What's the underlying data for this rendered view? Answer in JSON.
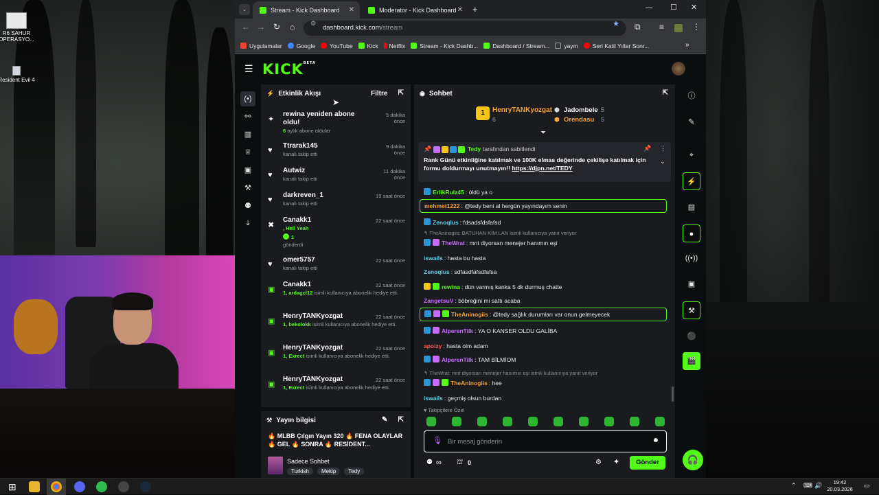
{
  "desktop": {
    "icons": [
      {
        "label": "R6 SAHUR OPERASYO..."
      },
      {
        "label": "Resident Evil 4"
      }
    ]
  },
  "browser": {
    "tabs": [
      {
        "label": "Stream - Kick Dashboard",
        "active": true
      },
      {
        "label": "Moderator - Kick Dashboard",
        "active": false
      }
    ],
    "new_tab_icon": "plus-icon",
    "url_host": "dashboard.kick.com",
    "url_path": "/stream",
    "bookmarks": [
      {
        "label": "Uygulamalar",
        "color": "#ea4335"
      },
      {
        "label": "Google",
        "color": "#4285f4"
      },
      {
        "label": "YouTube",
        "color": "#ff0000"
      },
      {
        "label": "Kick",
        "color": "#53fc18"
      },
      {
        "label": "Netflix",
        "color": "#e50914"
      },
      {
        "label": "Stream - Kick Dashb...",
        "color": "#53fc18"
      },
      {
        "label": "Dashboard / Stream...",
        "color": "#53fc18"
      },
      {
        "label": "yayın",
        "color": "#9aa0a6"
      },
      {
        "label": "Seri Katil Yıllar Sonr...",
        "color": "#ff0000"
      }
    ]
  },
  "kick": {
    "logo": "KICK",
    "logo_badge": "BETA",
    "accent": "#53fc18",
    "activity": {
      "title": "Etkinlik Akışı",
      "filter_label": "Filtre",
      "items": [
        {
          "name": "rewina yeniden abone oldu!",
          "sub_highlight": "6",
          "sub": " aylık abone oldular",
          "time": "5 dakika önce",
          "icon": "sparkle-icon"
        },
        {
          "name": "Ttrarak145",
          "sub": "kanalı takip etti",
          "time": "9 dakika önce",
          "icon": "heart-icon"
        },
        {
          "name": "Autwiz",
          "sub": "kanalı takip etti",
          "time": "11 dakika önce",
          "icon": "heart-icon"
        },
        {
          "name": "darkreven_1",
          "sub": "kanalı takip etti",
          "time": "19 saat önce",
          "icon": "heart-icon"
        },
        {
          "name": "Canakk1",
          "sub_highlight": ", Hell Yeah",
          "sub_count": "1",
          "sub": "gönderdi",
          "time": "22 saat önce",
          "icon": "kicks-icon"
        },
        {
          "name": "omer5757",
          "sub": "kanalı takip etti",
          "time": "22 saat önce",
          "icon": "heart-icon"
        },
        {
          "name": "Canakk1",
          "sub_highlight": "1, ardagcl12",
          "sub": " isimli kullanıcıya abonelik hediye etti.",
          "time": "22 saat önce",
          "icon": "gift-icon"
        },
        {
          "name": "HenryTANKyozgat",
          "sub_highlight": "1, bekolokk",
          "sub": " isimli kullanıcıya abonelik hediye etti.",
          "time": "22 saat önce",
          "icon": "gift-icon"
        },
        {
          "name": "HenryTANKyozgat",
          "sub_highlight": "1, Exrect",
          "sub": " isimli kullanıcıya abonelik hediye etti.",
          "time": "22 saat önce",
          "icon": "gift-icon"
        },
        {
          "name": "HenryTANKyozgat",
          "sub_highlight": "1, Exrect",
          "sub": " isimli kullanıcıya abonelik hediye etti.",
          "time": "22 saat önce",
          "icon": "gift-icon"
        }
      ]
    },
    "stream_info": {
      "title": "Yayın bilgisi",
      "stream_title": "🔥 MLBB Çılgın Yayın 320 🔥 FENA OLAYLAR 🔥 GEL 🔥 SONRA 🔥 RESİDENT...",
      "category": "Sadece Sohbet",
      "tags": [
        "Turkish",
        "Mekip",
        "Tedy"
      ]
    },
    "chat": {
      "title": "Sohbet",
      "leaderboard": [
        {
          "rank": "1",
          "name": "HenryTANKyozgat",
          "count": "6"
        },
        {
          "name": "Jadombele",
          "count": "5"
        },
        {
          "name": "Orendasu",
          "count": "5"
        }
      ],
      "pinned": {
        "author": "Tedy",
        "suffix": "tarafından sabitlendi",
        "text": "Rank Günü etkinliğine katılmak ve 100K elmas değerinde çekilişe katılmak için formu doldurmayı unutmayın!!",
        "link": "https://djpn.net/TEDY"
      },
      "messages": [
        {
          "user": "ErlikRulz45",
          "color": "#53fc18",
          "text": "öldü ya o",
          "badges": [
            "#2b95d6"
          ]
        },
        {
          "user": "mehmet1222",
          "color": "#f7a23b",
          "text": "@tedy beni al hergün yayındayım senin",
          "highlight": true
        },
        {
          "user": "Zenoqlus",
          "color": "#5fd4e8",
          "text": "fdsadsfdsfafsd",
          "badges": [
            "#2b95d6"
          ]
        },
        {
          "reply": "TheAninogiis: BATUHAN KİM LAN isimli kullanıcıya yanıt veriyor"
        },
        {
          "user": "TheWrat",
          "color": "#c86bff",
          "text": "mnt diyorsan menejer hanımın eşi",
          "badges": [
            "#2b95d6",
            "#c86bff"
          ]
        },
        {
          "user": "iswails",
          "color": "#5fd4e8",
          "text": "hasta bu hasta"
        },
        {
          "user": "Zenoqlus",
          "color": "#5fd4e8",
          "text": "sdfasdfafsdfafsa"
        },
        {
          "user": "rewina",
          "color": "#53fc18",
          "text": "dün varmış kanka 5 dk durmuş chatte",
          "badges": [
            "#f5c518",
            "#53fc18"
          ]
        },
        {
          "user": "ZangetsuV",
          "color": "#c86bff",
          "text": "böbreğini mi sattı acaba"
        },
        {
          "user": "TheAninogiis",
          "color": "#f7a23b",
          "text": "@tedy sağlık durumları var onun gelmeyecek",
          "highlight": true,
          "badges": [
            "#2b95d6",
            "#c86bff",
            "#53fc18"
          ]
        },
        {
          "user": "AlperenTilk",
          "color": "#c86bff",
          "text": "YA O KANSER OLDU GALİBA",
          "badges": [
            "#2b95d6",
            "#c86bff"
          ]
        },
        {
          "user": "apoizy",
          "color": "#ff5a5a",
          "text": "hasta olm adam"
        },
        {
          "user": "AlperenTilk",
          "color": "#c86bff",
          "text": "TAM BİLMİOM",
          "badges": [
            "#2b95d6",
            "#c86bff"
          ]
        },
        {
          "reply": "TheWrat: mnt diyorsan menejer hanımın eşi isimli kullanıcıya yanıt veriyor"
        },
        {
          "user": "TheAninogiis",
          "color": "#f7a23b",
          "text": "hee",
          "badges": [
            "#2b95d6",
            "#c86bff",
            "#53fc18"
          ]
        },
        {
          "user": "iswails",
          "color": "#5fd4e8",
          "text": "geçmiş olsun burdan"
        }
      ],
      "emote_row_label": "Takipçilere Özel",
      "input_placeholder": "Bir mesaj gönderin",
      "viewers": "∞",
      "points": "0",
      "send_label": "Gönder"
    }
  },
  "taskbar": {
    "time": "19:42",
    "date": "20.03.2026"
  }
}
